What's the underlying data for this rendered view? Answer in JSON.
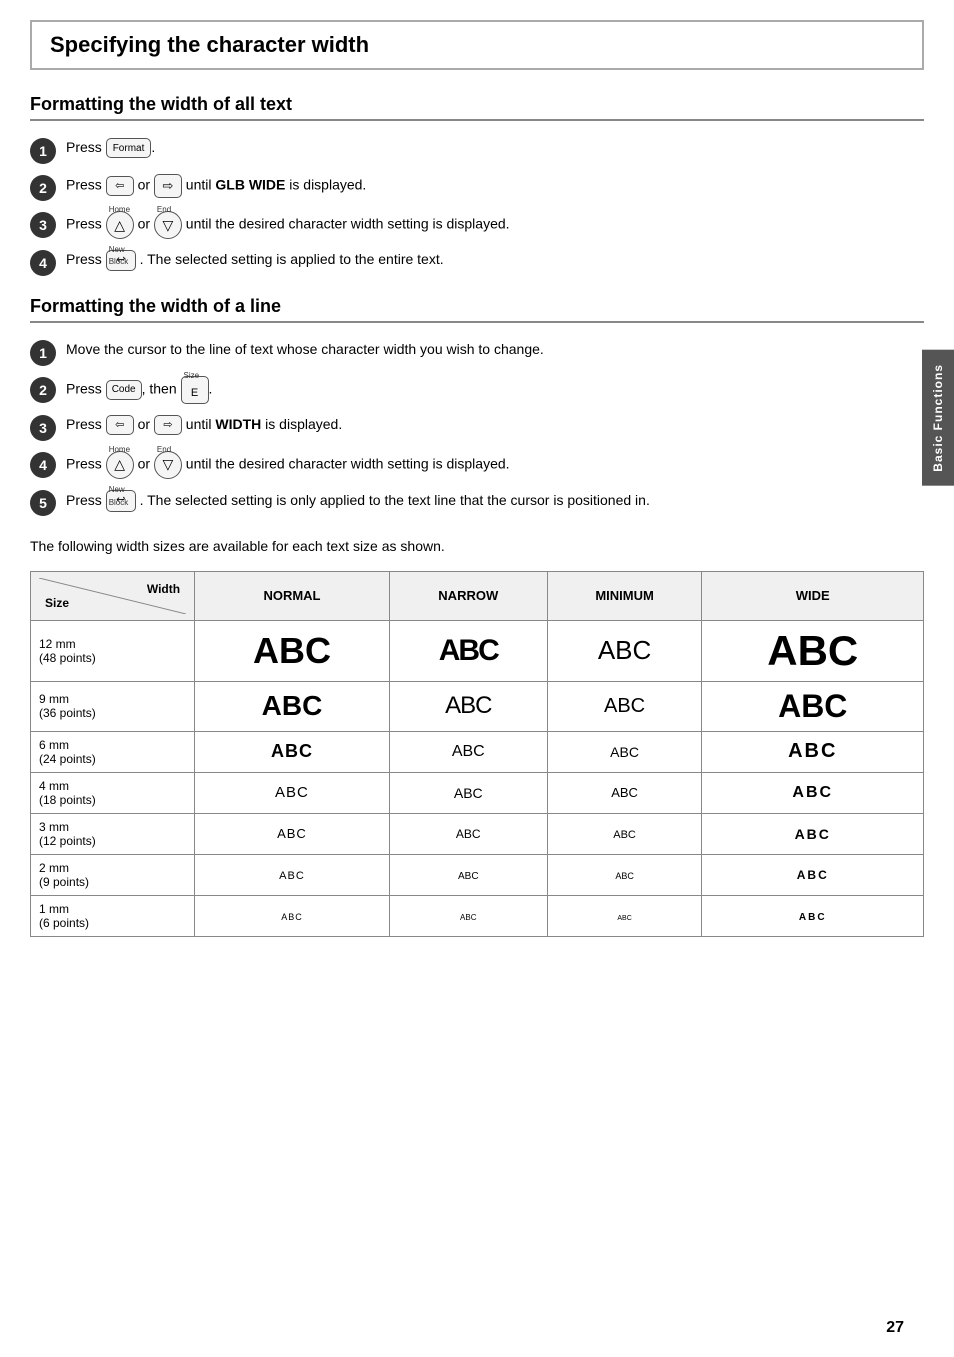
{
  "page": {
    "title": "Specifying the character width",
    "page_number": "27",
    "side_tab_label": "Basic Functions"
  },
  "section1": {
    "heading": "Formatting the width of all text",
    "steps": [
      {
        "num": "1",
        "text": "Press [Format]."
      },
      {
        "num": "2",
        "text_before": "Press",
        "key1": "←",
        "or": "or",
        "key2": "→",
        "text_after": "until GLB WIDE is displayed.",
        "bold": "GLB WIDE"
      },
      {
        "num": "3",
        "text_before": "Press",
        "key1": "▲",
        "key1_super": "Home",
        "or": "or",
        "key2": "▼",
        "key2_super": "End",
        "text_after": "until the desired character width setting is displayed."
      },
      {
        "num": "4",
        "text_before": "Press",
        "key": "↵",
        "key_super": "New Block",
        "text_after": ". The selected setting is applied to the entire text."
      }
    ]
  },
  "section2": {
    "heading": "Formatting the width of a line",
    "steps": [
      {
        "num": "1",
        "text": "Move the cursor to the line of text whose character width you wish to change."
      },
      {
        "num": "2",
        "text_before": "Press",
        "key1": "Code",
        "then": ", then",
        "key2": "E",
        "key2_super": "Size",
        "text_after": "."
      },
      {
        "num": "3",
        "text_before": "Press",
        "key1": "←",
        "or": "or",
        "key2": "→",
        "text_after": "until WIDTH is displayed.",
        "bold": "WIDTH"
      },
      {
        "num": "4",
        "text_before": "Press",
        "key1": "▲",
        "key1_super": "Home",
        "or": "or",
        "key2": "▼",
        "key2_super": "End",
        "text_after": "until the desired character width setting is displayed."
      },
      {
        "num": "5",
        "text_before": "Press",
        "key": "↵",
        "key_super": "New Block",
        "text_after": ". The selected setting is only applied to the text line that the cursor is positioned in."
      }
    ]
  },
  "intro_text": "The following width sizes are available for each text size as shown.",
  "table": {
    "corner_top": "Width",
    "corner_bottom": "Size",
    "columns": [
      "NORMAL",
      "NARROW",
      "MINIMUM",
      "WIDE"
    ],
    "rows": [
      {
        "size": "12 mm\n(48 points)",
        "values": [
          "ABC",
          "ABC",
          "ABC",
          "ABC"
        ],
        "classes": [
          "abc-48-normal",
          "abc-48-narrow",
          "abc-48-minimum",
          "abc-48-wide"
        ]
      },
      {
        "size": "9 mm\n(36 points)",
        "values": [
          "ABC",
          "ABC",
          "ABC",
          "ABC"
        ],
        "classes": [
          "abc-36-normal",
          "abc-36-narrow",
          "abc-36-minimum",
          "abc-36-wide"
        ]
      },
      {
        "size": "6 mm\n(24 points)",
        "values": [
          "ABC",
          "ABC",
          "ABC",
          "ABC"
        ],
        "classes": [
          "abc-24-normal",
          "abc-24-narrow",
          "abc-24-minimum",
          "abc-24-wide"
        ]
      },
      {
        "size": "4 mm\n(18 points)",
        "values": [
          "ABC",
          "ABC",
          "ABC",
          "ABC"
        ],
        "classes": [
          "abc-18-normal",
          "abc-18-narrow",
          "abc-18-minimum",
          "abc-18-wide"
        ]
      },
      {
        "size": "3 mm\n(12 points)",
        "values": [
          "ABC",
          "ABC",
          "ABC",
          "ABC"
        ],
        "classes": [
          "abc-12-normal",
          "abc-12-narrow",
          "abc-12-minimum",
          "abc-12-wide"
        ]
      },
      {
        "size": "2 mm\n(9 points)",
        "values": [
          "ABC",
          "ABC",
          "ABC",
          "ABC"
        ],
        "classes": [
          "abc-9-normal",
          "abc-9-narrow",
          "abc-9-minimum",
          "abc-9-wide"
        ]
      },
      {
        "size": "1 mm\n(6 points)",
        "values": [
          "ABC",
          "ABC",
          "ABC",
          "ABC"
        ],
        "classes": [
          "abc-6-normal",
          "abc-6-narrow",
          "abc-6-minimum",
          "abc-6-wide"
        ]
      }
    ]
  }
}
